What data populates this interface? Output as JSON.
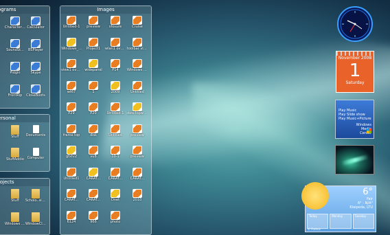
{
  "fences": {
    "programs": {
      "title": "ograms",
      "items": [
        {
          "label": "Character Ninja"
        },
        {
          "label": "Calculator"
        },
        {
          "label": "SoundSt..."
        },
        {
          "label": "BSPlayer"
        },
        {
          "label": "Pidgin"
        },
        {
          "label": "Skype"
        },
        {
          "label": "FrontRip"
        },
        {
          "label": "CloseBoots"
        }
      ]
    },
    "images": {
      "title": "Images",
      "items": [
        {
          "label": "Untitled-1"
        },
        {
          "label": "preview"
        },
        {
          "label": "sfosure"
        },
        {
          "label": "Cruise"
        },
        {
          "label": "Windows_..."
        },
        {
          "label": "Project1"
        },
        {
          "label": "wlan1 overlan"
        },
        {
          "label": "toolbar view"
        },
        {
          "label": "view1 overlan"
        },
        {
          "label": "widepanel"
        },
        {
          "label": "P14"
        },
        {
          "label": "Windows V..."
        },
        {
          "label": "wt67"
        },
        {
          "label": "1"
        },
        {
          "label": "2009"
        },
        {
          "label": "Untitled"
        },
        {
          "label": "P29"
        },
        {
          "label": "P20"
        },
        {
          "label": "Untitled-1"
        },
        {
          "label": "desctopwo..."
        },
        {
          "label": "frame top"
        },
        {
          "label": "disk"
        },
        {
          "label": "Untitled"
        },
        {
          "label": "preview"
        },
        {
          "label": "gfxtv2"
        },
        {
          "label": "vu8"
        },
        {
          "label": "10-1"
        },
        {
          "label": "preview"
        },
        {
          "label": "Untitled1"
        },
        {
          "label": "CARAT..."
        },
        {
          "label": "CARAT..."
        },
        {
          "label": "CARAT..."
        },
        {
          "label": "CARAT..."
        },
        {
          "label": "CARAT..."
        },
        {
          "label": "Dnet"
        },
        {
          "label": "2010"
        },
        {
          "label": "6124"
        },
        {
          "label": "966"
        },
        {
          "label": "photo"
        }
      ]
    },
    "personal": {
      "title": "ersonal",
      "items": [
        {
          "label": "Stuff"
        },
        {
          "label": "Documents"
        },
        {
          "label": "StuffAddio"
        },
        {
          "label": "Computer"
        }
      ]
    },
    "projects": {
      "title": "rojects",
      "items": [
        {
          "label": "Stuff"
        },
        {
          "label": "Scholo..site project"
        },
        {
          "label": "Windows 7 system files"
        },
        {
          "label": "WindowCl.. image"
        }
      ]
    }
  },
  "gadgets": {
    "calendar": {
      "month": "November 2008",
      "day": "1",
      "weekday": "Saturday"
    },
    "media_center": {
      "items": [
        "Play Music",
        "Play Slide show",
        "Play Music+Picture"
      ],
      "brand": "Windows Media Center"
    },
    "weather": {
      "temp": "6°",
      "condition": "Fair",
      "range": "6° - N/A°",
      "location": "Klaipeda, LTU",
      "days": [
        "Today",
        "Monday",
        "Tuesday"
      ],
      "source": "© Foreca"
    }
  },
  "colors": {
    "calendar_orange": "#e8622a",
    "media_blue": "#2b5fb0"
  }
}
